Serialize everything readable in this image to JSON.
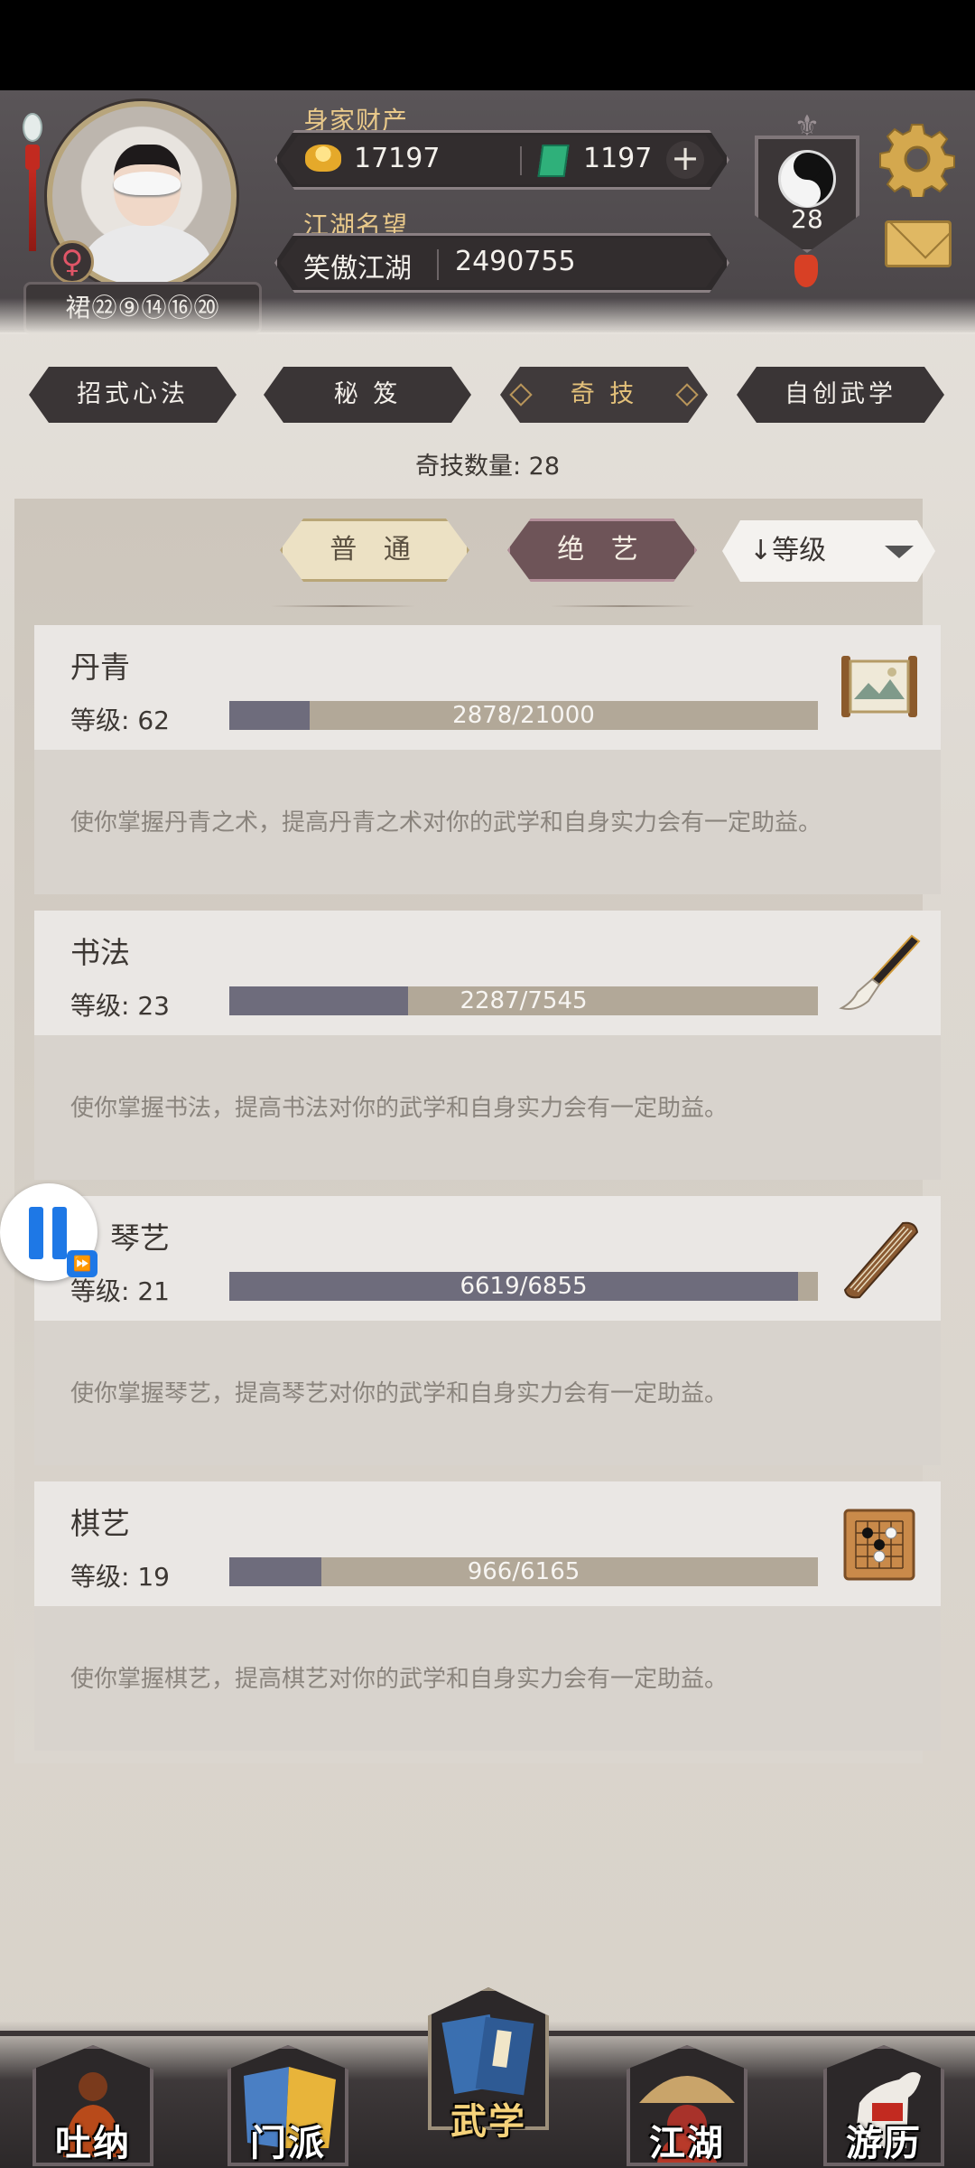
{
  "header": {
    "wealth_label": "身家财产",
    "gold": "17197",
    "jade": "1197",
    "plus": "+",
    "fame_label": "江湖名望",
    "fame_title": "笑傲江湖",
    "fame_value": "2490755",
    "gender_symbol": "♀",
    "player_name": "裙㉒⑨⑭⑯⑳",
    "level": "28"
  },
  "tabs": [
    {
      "label": "招式心法",
      "active": false
    },
    {
      "label": "秘 笈",
      "active": false
    },
    {
      "label": "奇 技",
      "active": true
    },
    {
      "label": "自创武学",
      "active": false
    }
  ],
  "count_text": "奇技数量: 28",
  "filters": {
    "normal": "普 通",
    "special": "绝 艺",
    "sort": "↓等级"
  },
  "skills": [
    {
      "name": "丹青",
      "level": "等级: 62",
      "progress": "2878/21000",
      "fraction": 0.137,
      "desc": "使你掌握丹青之术，提高丹青之术对你的武学和自身实力会有一定助益。",
      "icon": "scroll-painting-icon"
    },
    {
      "name": "书法",
      "level": "等级: 23",
      "progress": "2287/7545",
      "fraction": 0.303,
      "desc": "使你掌握书法，提高书法对你的武学和自身实力会有一定助益。",
      "icon": "brush-icon"
    },
    {
      "name": "琴艺",
      "level": "等级: 21",
      "progress": "6619/6855",
      "fraction": 0.966,
      "desc": "使你掌握琴艺，提高琴艺对你的武学和自身实力会有一定助益。",
      "icon": "guqin-icon"
    },
    {
      "name": "棋艺",
      "level": "等级: 19",
      "progress": "966/6165",
      "fraction": 0.157,
      "desc": "使你掌握棋艺，提高棋艺对你的武学和自身实力会有一定助益。",
      "icon": "go-board-icon"
    }
  ],
  "nav": [
    {
      "label": "吐纳",
      "active": false
    },
    {
      "label": "门派",
      "active": false
    },
    {
      "label": "武学",
      "active": true
    },
    {
      "label": "江湖",
      "active": false
    },
    {
      "label": "游历",
      "active": false
    }
  ],
  "colors": {
    "header_bg": "#4f4a4c",
    "gold_text": "#e9c98a",
    "bar_fill": "#6e6c7c",
    "bar_track": "#b2a898",
    "pause_blue": "#1e78e6"
  }
}
